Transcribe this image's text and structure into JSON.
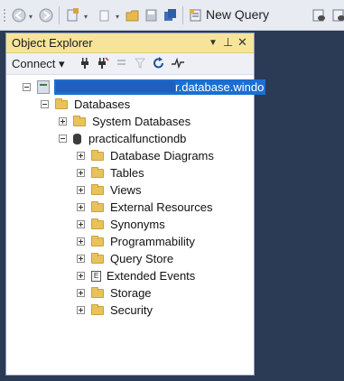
{
  "toolbar": {
    "new_query_label": "New Query",
    "icons": [
      "back-icon",
      "forward-icon",
      "new-project-icon",
      "add-item-icon",
      "open-file-icon",
      "save-icon",
      "save-all-icon",
      "new-query-icon",
      "database-query-icon"
    ]
  },
  "panel": {
    "title": "Object Explorer",
    "pin_glyph": "▾ ⊥ ✕",
    "connect_label": "Connect ▾"
  },
  "tree": {
    "server_label_visible": "r.database.windo",
    "databases": "Databases",
    "system_databases": "System Databases",
    "database_name": "practicalfunctiondb",
    "children": [
      {
        "label": "Database Diagrams",
        "icon": "folder-icon"
      },
      {
        "label": "Tables",
        "icon": "folder-icon"
      },
      {
        "label": "Views",
        "icon": "folder-icon"
      },
      {
        "label": "External Resources",
        "icon": "folder-icon"
      },
      {
        "label": "Synonyms",
        "icon": "folder-icon"
      },
      {
        "label": "Programmability",
        "icon": "folder-icon"
      },
      {
        "label": "Query Store",
        "icon": "folder-icon"
      },
      {
        "label": "Extended Events",
        "icon": "extended-events-icon"
      },
      {
        "label": "Storage",
        "icon": "folder-icon"
      },
      {
        "label": "Security",
        "icon": "folder-icon"
      }
    ]
  },
  "colors": {
    "title_bar": "#f6e49a",
    "selection": "#1a6fd1",
    "workspace": "#2b3a55"
  }
}
